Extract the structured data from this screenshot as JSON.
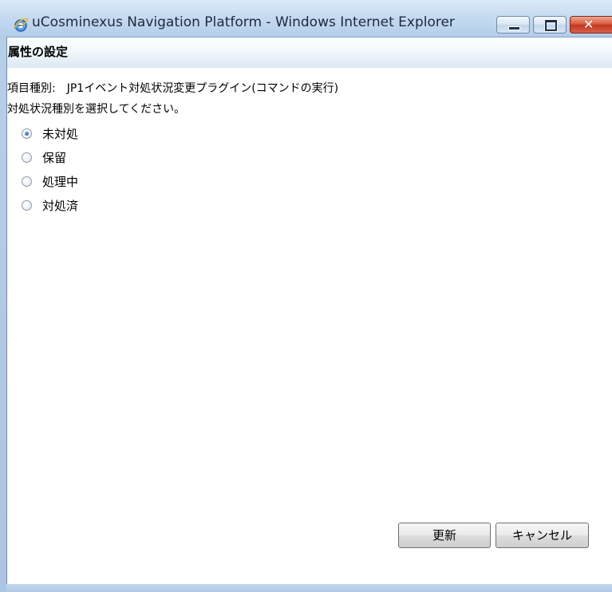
{
  "window": {
    "title": "uCosminexus Navigation Platform - Windows Internet Explorer",
    "icon": "ie-icon",
    "controls": {
      "minimize_icon": "minimize-icon",
      "maximize_icon": "maximize-icon",
      "close_icon": "close-icon"
    }
  },
  "page": {
    "title": "属性の設定",
    "item_type_label": "項目種別:",
    "item_type_value": "JP1イベント対処状況変更プラグイン(コマンドの実行)",
    "instruction": "対処状況種別を選択してください。"
  },
  "options": [
    {
      "label": "未対処",
      "checked": true
    },
    {
      "label": "保留",
      "checked": false
    },
    {
      "label": "処理中",
      "checked": false
    },
    {
      "label": "対処済",
      "checked": false
    }
  ],
  "buttons": {
    "update": "更新",
    "cancel": "キャンセル"
  }
}
